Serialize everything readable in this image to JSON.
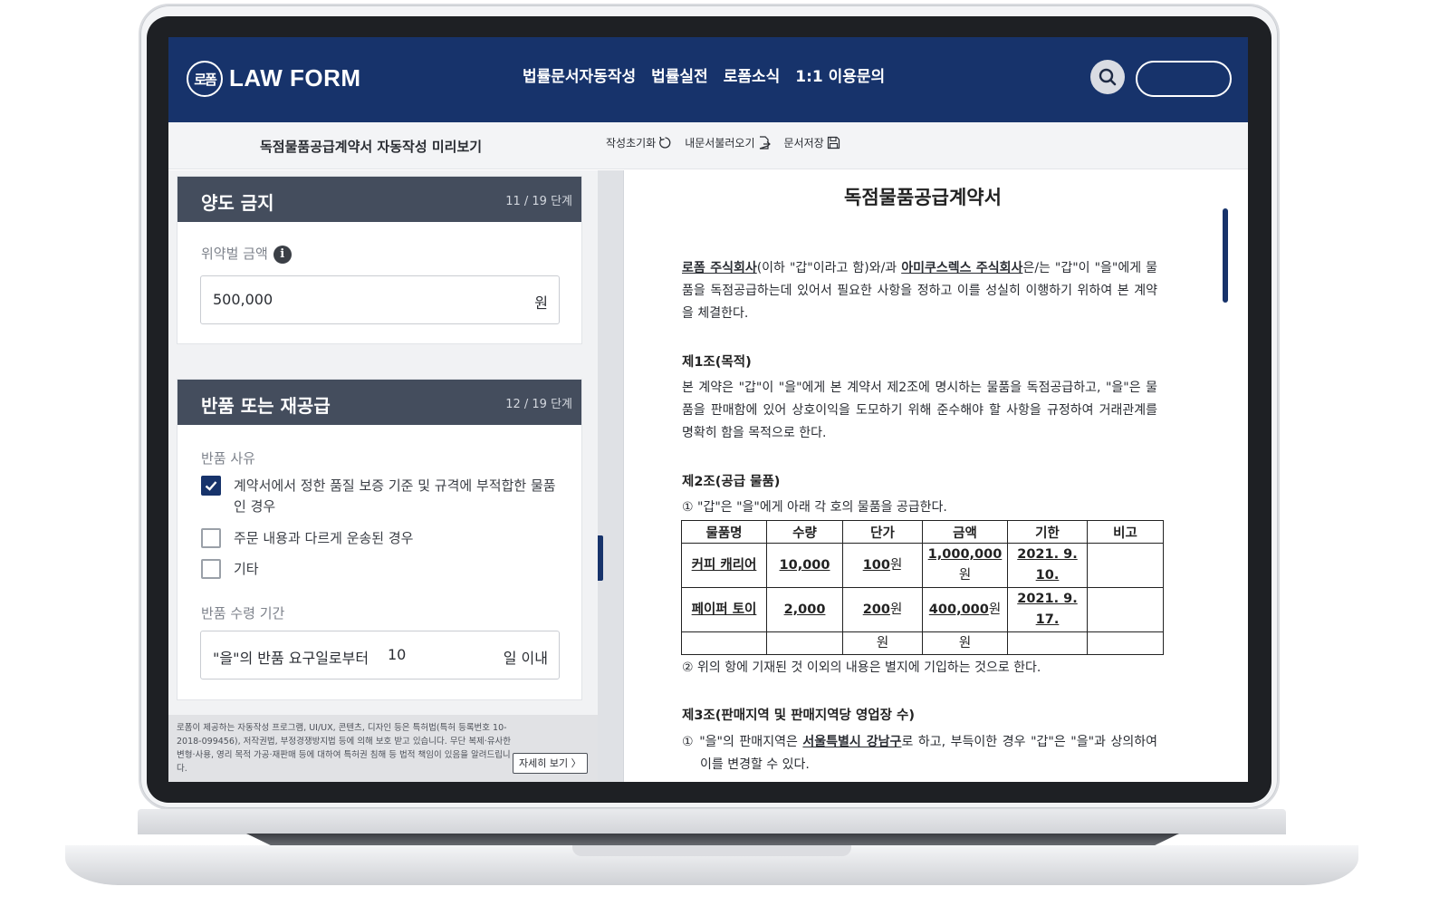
{
  "header": {
    "logo_mark": "로폼",
    "logo_text": "LAW FORM",
    "nav": [
      "법률문서자동작성",
      "법률실전",
      "로폼소식",
      "1:1 이용문의"
    ]
  },
  "toolbar": {
    "title": "독점물품공급계약서 자동작성 미리보기",
    "reset": "작성초기화",
    "load": "내문서불러오기",
    "save": "문서저장"
  },
  "form": {
    "card1": {
      "title": "양도 금지",
      "step": "11 / 19 단계",
      "penalty_label": "위약벌 금액",
      "penalty_value": "500,000",
      "penalty_unit": "원"
    },
    "card2": {
      "title": "반품 또는 재공급",
      "step": "12 / 19 단계",
      "reason_label": "반품 사유",
      "reasons": [
        {
          "label": "계약서에서 정한 품질 보증 기준 및 규격에 부적합한 물품인 경우",
          "checked": true
        },
        {
          "label": "주문 내용과 다르게 운송된 경우",
          "checked": false
        },
        {
          "label": "기타",
          "checked": false
        }
      ],
      "period_label": "반품 수령 기간",
      "period_prefix": "\"을\"의 반품 요구일로부터",
      "period_value": "10",
      "period_suffix": "일 이내"
    }
  },
  "footer": {
    "notice": "로폼이 제공하는 자동작성 프로그램, UI/UX, 콘텐츠, 디자인 등은 특허법(특허 등록번호 10-2018-099456), 저작권법, 부정경쟁방지법 등에 의해 보호 받고 있습니다. 무단 복제·유사한 변형·사용, 영리 목적 가공·재판매 등에 대하여 특허권 침해 등 법적 책임이 있음을 알려드립니다.",
    "more": "자세히 보기 〉"
  },
  "document": {
    "title": "독점물품공급계약서",
    "party_a": "로폼 주식회사",
    "intro_mid": "(이하 \"갑\"이라고 함)와/과 ",
    "party_b": "아미쿠스렉스 주식회사",
    "intro_end": "은/는 \"갑\"이 \"을\"에게 물품을 독점공급하는데 있어서 필요한 사항을 정하고 이를 성실히 이행하기 위하여 본 계약을 체결한다.",
    "art1_title": "제1조(목적)",
    "art1_body": "본 계약은 \"갑\"이 \"을\"에게 본 계약서 제2조에 명시하는 물품을 독점공급하고, \"을\"은 물품을 판매함에 있어 상호이익을 도모하기 위해 준수해야 할 사항을 규정하여 거래관계를 명확히 함을 목적으로 한다.",
    "art2_title": "제2조(공급 물품)",
    "art2_p1": "① \"갑\"은 \"을\"에게 아래 각 호의 물품을 공급한다.",
    "table_headers": [
      "물품명",
      "수량",
      "단가",
      "금액",
      "기한",
      "비고"
    ],
    "table_rows": [
      {
        "name": "커피 캐리어",
        "qty": "10,000",
        "unit_num": "100",
        "unit": "원",
        "amount_num": "1,000,000",
        "amount_unit": "원",
        "due": "2021. 9. 10.",
        "note": ""
      },
      {
        "name": "페이퍼 토이",
        "qty": "2,000",
        "unit_num": "200",
        "unit": "원",
        "amount_num": "400,000",
        "amount_unit": "원",
        "due": "2021. 9. 17.",
        "note": ""
      },
      {
        "name": "",
        "qty": "",
        "unit_num": "",
        "unit": "원",
        "amount_num": "",
        "amount_unit": "원",
        "due": "",
        "note": ""
      }
    ],
    "art2_p2": "② 위의 항에 기재된 것 이외의 내용은 별지에 기입하는 것으로 한다.",
    "art3_title": "제3조(판매지역 및 판매지역당 영업장 수)",
    "art3_p1_a": "① \"을\"의 판매지역은 ",
    "art3_region": "서울특별시 강남구",
    "art3_p1_b": "로 하고, 부득이한 경우 \"갑\"은 \"을\"과 상의하여 이를 변경할 수 있다."
  },
  "colors": {
    "brand": "#17336b",
    "card_head": "#444d5d"
  },
  "icons": [
    "search-icon",
    "reset-icon",
    "load-document-icon",
    "save-icon",
    "info-icon",
    "check-icon"
  ]
}
